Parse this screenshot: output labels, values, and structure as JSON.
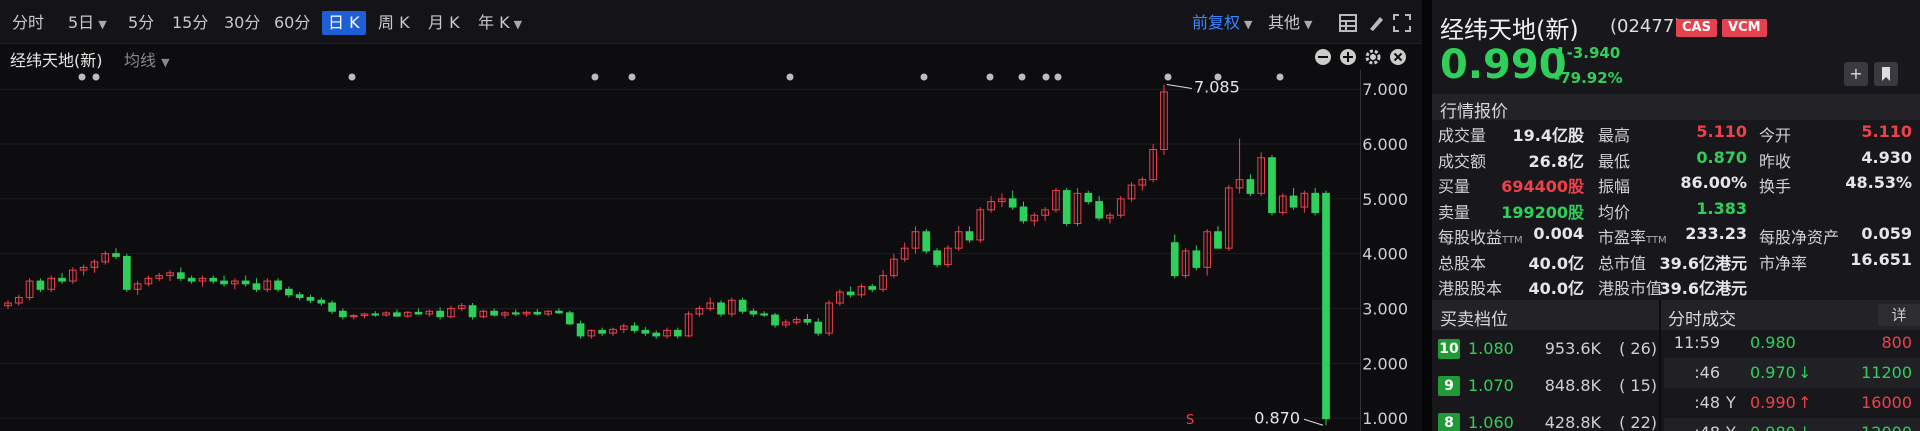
{
  "toolbar": {
    "periods": [
      {
        "label": "分时",
        "caret": false,
        "active": false
      },
      {
        "label": "5日",
        "caret": true,
        "active": false
      },
      {
        "label": "5分",
        "caret": false,
        "active": false
      },
      {
        "label": "15分",
        "caret": false,
        "active": false
      },
      {
        "label": "30分",
        "caret": false,
        "active": false
      },
      {
        "label": "60分",
        "caret": false,
        "active": false
      },
      {
        "label": "日 K",
        "caret": false,
        "active": true
      },
      {
        "label": "周 K",
        "caret": false,
        "active": false
      },
      {
        "label": "月 K",
        "caret": false,
        "active": false
      },
      {
        "label": "年 K",
        "caret": true,
        "active": false
      }
    ],
    "adjust_label": "前复权",
    "other_label": "其他"
  },
  "chart_header": {
    "symbol_label": "经纬天地(新)",
    "indicator_label": "均线"
  },
  "chart_data": {
    "type": "candlestick",
    "y_axis_ticks": [
      "7.000",
      "6.000",
      "5.000",
      "4.000",
      "3.000",
      "2.000",
      "1.000"
    ],
    "ylim": [
      0.82,
      7.35
    ],
    "max_annotation": "7.085",
    "min_annotation": "0.870",
    "marker_label": "S",
    "colors": {
      "up": "#f0404a",
      "down": "#2fd05a"
    },
    "candles": [
      [
        3.05,
        3.15,
        3.0,
        3.1
      ],
      [
        3.1,
        3.25,
        3.05,
        3.2
      ],
      [
        3.2,
        3.55,
        3.15,
        3.5
      ],
      [
        3.5,
        3.55,
        3.3,
        3.35
      ],
      [
        3.35,
        3.6,
        3.3,
        3.55
      ],
      [
        3.55,
        3.65,
        3.45,
        3.5
      ],
      [
        3.5,
        3.75,
        3.45,
        3.7
      ],
      [
        3.7,
        3.8,
        3.6,
        3.75
      ],
      [
        3.75,
        3.9,
        3.65,
        3.85
      ],
      [
        3.85,
        4.05,
        3.8,
        4.0
      ],
      [
        4.0,
        4.1,
        3.9,
        3.95
      ],
      [
        3.95,
        4.0,
        3.3,
        3.35
      ],
      [
        3.35,
        3.5,
        3.25,
        3.45
      ],
      [
        3.45,
        3.6,
        3.4,
        3.55
      ],
      [
        3.55,
        3.65,
        3.5,
        3.6
      ],
      [
        3.6,
        3.7,
        3.5,
        3.65
      ],
      [
        3.65,
        3.75,
        3.5,
        3.55
      ],
      [
        3.55,
        3.6,
        3.45,
        3.5
      ],
      [
        3.5,
        3.6,
        3.4,
        3.55
      ],
      [
        3.55,
        3.6,
        3.45,
        3.5
      ],
      [
        3.5,
        3.6,
        3.4,
        3.45
      ],
      [
        3.45,
        3.55,
        3.35,
        3.5
      ],
      [
        3.5,
        3.6,
        3.4,
        3.45
      ],
      [
        3.45,
        3.55,
        3.3,
        3.35
      ],
      [
        3.35,
        3.55,
        3.3,
        3.5
      ],
      [
        3.5,
        3.55,
        3.3,
        3.35
      ],
      [
        3.35,
        3.4,
        3.2,
        3.25
      ],
      [
        3.25,
        3.3,
        3.15,
        3.2
      ],
      [
        3.2,
        3.25,
        3.1,
        3.15
      ],
      [
        3.15,
        3.2,
        3.05,
        3.1
      ],
      [
        3.1,
        3.15,
        2.9,
        2.95
      ],
      [
        2.95,
        3.0,
        2.8,
        2.85
      ],
      [
        2.85,
        2.9,
        2.8,
        2.87
      ],
      [
        2.87,
        2.92,
        2.82,
        2.9
      ],
      [
        2.9,
        2.95,
        2.85,
        2.88
      ],
      [
        2.88,
        2.95,
        2.85,
        2.92
      ],
      [
        2.92,
        2.98,
        2.85,
        2.86
      ],
      [
        2.86,
        2.95,
        2.83,
        2.93
      ],
      [
        2.93,
        3.0,
        2.88,
        2.9
      ],
      [
        2.9,
        2.98,
        2.85,
        2.95
      ],
      [
        2.95,
        3.02,
        2.8,
        2.85
      ],
      [
        2.85,
        3.05,
        2.82,
        3.0
      ],
      [
        3.0,
        3.1,
        2.95,
        3.05
      ],
      [
        3.05,
        3.1,
        2.8,
        2.85
      ],
      [
        2.85,
        2.98,
        2.82,
        2.95
      ],
      [
        2.95,
        3.0,
        2.85,
        2.88
      ],
      [
        2.88,
        2.95,
        2.82,
        2.92
      ],
      [
        2.92,
        2.98,
        2.86,
        2.9
      ],
      [
        2.9,
        2.96,
        2.85,
        2.93
      ],
      [
        2.93,
        2.99,
        2.87,
        2.9
      ],
      [
        2.9,
        2.97,
        2.86,
        2.95
      ],
      [
        2.95,
        3.0,
        2.9,
        2.92
      ],
      [
        2.92,
        2.96,
        2.7,
        2.72
      ],
      [
        2.72,
        2.78,
        2.45,
        2.5
      ],
      [
        2.5,
        2.62,
        2.45,
        2.6
      ],
      [
        2.6,
        2.65,
        2.5,
        2.55
      ],
      [
        2.55,
        2.65,
        2.5,
        2.62
      ],
      [
        2.62,
        2.72,
        2.55,
        2.68
      ],
      [
        2.68,
        2.75,
        2.55,
        2.6
      ],
      [
        2.6,
        2.66,
        2.5,
        2.55
      ],
      [
        2.55,
        2.6,
        2.45,
        2.5
      ],
      [
        2.5,
        2.65,
        2.45,
        2.6
      ],
      [
        2.6,
        2.65,
        2.45,
        2.5
      ],
      [
        2.5,
        2.95,
        2.48,
        2.9
      ],
      [
        2.9,
        3.05,
        2.85,
        3.0
      ],
      [
        3.0,
        3.2,
        2.95,
        3.1
      ],
      [
        3.1,
        3.15,
        2.85,
        2.9
      ],
      [
        2.9,
        3.2,
        2.85,
        3.15
      ],
      [
        3.15,
        3.2,
        2.9,
        2.95
      ],
      [
        2.95,
        3.0,
        2.85,
        2.9
      ],
      [
        2.9,
        2.95,
        2.85,
        2.88
      ],
      [
        2.88,
        2.92,
        2.65,
        2.7
      ],
      [
        2.7,
        2.8,
        2.65,
        2.75
      ],
      [
        2.75,
        2.85,
        2.7,
        2.8
      ],
      [
        2.8,
        2.9,
        2.7,
        2.75
      ],
      [
        2.75,
        2.82,
        2.5,
        2.55
      ],
      [
        2.55,
        3.15,
        2.5,
        3.1
      ],
      [
        3.1,
        3.35,
        3.05,
        3.3
      ],
      [
        3.3,
        3.4,
        3.2,
        3.25
      ],
      [
        3.25,
        3.45,
        3.2,
        3.4
      ],
      [
        3.4,
        3.45,
        3.3,
        3.35
      ],
      [
        3.35,
        3.7,
        3.3,
        3.6
      ],
      [
        3.6,
        4.0,
        3.55,
        3.9
      ],
      [
        3.9,
        4.2,
        3.85,
        4.1
      ],
      [
        4.1,
        4.5,
        4.0,
        4.4
      ],
      [
        4.4,
        4.45,
        4.0,
        4.05
      ],
      [
        4.05,
        4.1,
        3.75,
        3.8
      ],
      [
        3.8,
        4.15,
        3.75,
        4.1
      ],
      [
        4.1,
        4.5,
        4.05,
        4.4
      ],
      [
        4.4,
        4.5,
        4.2,
        4.25
      ],
      [
        4.25,
        4.85,
        4.2,
        4.8
      ],
      [
        4.8,
        5.05,
        4.75,
        4.95
      ],
      [
        4.95,
        5.1,
        4.85,
        5.0
      ],
      [
        5.0,
        5.15,
        4.8,
        4.85
      ],
      [
        4.85,
        4.95,
        4.55,
        4.6
      ],
      [
        4.6,
        4.75,
        4.5,
        4.7
      ],
      [
        4.7,
        4.85,
        4.6,
        4.8
      ],
      [
        4.8,
        5.2,
        4.75,
        5.15
      ],
      [
        5.15,
        5.2,
        4.5,
        4.55
      ],
      [
        4.55,
        5.2,
        4.5,
        5.1
      ],
      [
        5.1,
        5.15,
        4.9,
        4.95
      ],
      [
        4.95,
        5.05,
        4.6,
        4.65
      ],
      [
        4.65,
        4.75,
        4.55,
        4.7
      ],
      [
        4.7,
        5.05,
        4.65,
        5.0
      ],
      [
        5.0,
        5.3,
        4.95,
        5.25
      ],
      [
        5.25,
        5.4,
        5.15,
        5.35
      ],
      [
        5.35,
        6.0,
        5.3,
        5.9
      ],
      [
        5.9,
        7.085,
        5.8,
        6.95
      ],
      [
        4.2,
        4.35,
        3.55,
        3.6
      ],
      [
        3.6,
        4.1,
        3.55,
        4.05
      ],
      [
        4.05,
        4.15,
        3.7,
        3.75
      ],
      [
        3.75,
        4.45,
        3.6,
        4.4
      ],
      [
        4.4,
        4.5,
        4.1,
        4.1
      ],
      [
        4.1,
        5.25,
        4.05,
        5.2
      ],
      [
        5.2,
        6.1,
        5.1,
        5.35
      ],
      [
        5.35,
        5.45,
        5.05,
        5.1
      ],
      [
        5.1,
        5.85,
        5.05,
        5.75
      ],
      [
        5.75,
        5.8,
        4.7,
        4.75
      ],
      [
        4.75,
        5.1,
        4.7,
        5.05
      ],
      [
        5.05,
        5.2,
        4.8,
        4.85
      ],
      [
        4.85,
        5.15,
        4.75,
        5.1
      ],
      [
        5.1,
        5.2,
        4.7,
        4.75
      ],
      [
        5.1,
        5.15,
        0.87,
        0.99
      ]
    ]
  },
  "quote": {
    "name": "经纬天地(新)",
    "code": "(02477)",
    "badges": [
      "CAS",
      "VCM"
    ],
    "price": "0.990",
    "change": "-3.940",
    "change_pct": "-79.92%",
    "section_title": "行情报价",
    "rows": [
      [
        {
          "label": "成交量",
          "value": "19.4亿股",
          "color": "white"
        },
        {
          "label": "最高",
          "value": "5.110",
          "color": "red"
        },
        {
          "label": "今开",
          "value": "5.110",
          "color": "red"
        }
      ],
      [
        {
          "label": "成交额",
          "value": "26.8亿",
          "color": "white"
        },
        {
          "label": "最低",
          "value": "0.870",
          "color": "green"
        },
        {
          "label": "昨收",
          "value": "4.930",
          "color": "white"
        }
      ],
      [
        {
          "label": "买量",
          "value": "694400股",
          "color": "red"
        },
        {
          "label": "振幅",
          "value": "86.00%",
          "color": "white"
        },
        {
          "label": "换手",
          "value": "48.53%",
          "color": "white"
        }
      ],
      [
        {
          "label": "卖量",
          "value": "199200股",
          "color": "green"
        },
        {
          "label": "均价",
          "value": "1.383",
          "color": "green"
        },
        {
          "label": "",
          "value": "",
          "color": "white"
        }
      ],
      [
        {
          "label": "每股收益",
          "sub": "TTM",
          "value": "0.004",
          "color": "white"
        },
        {
          "label": "市盈率",
          "sub": "TTM",
          "value": "233.23",
          "color": "white"
        },
        {
          "label": "每股净资产",
          "value": "0.059",
          "color": "white"
        }
      ],
      [
        {
          "label": "总股本",
          "value": "40.0亿",
          "color": "white"
        },
        {
          "label": "总市值",
          "value": "39.6亿港元",
          "color": "white"
        },
        {
          "label": "市净率",
          "value": "16.651",
          "color": "white"
        }
      ],
      [
        {
          "label": "港股股本",
          "value": "40.0亿",
          "color": "white"
        },
        {
          "label": "港股市值",
          "value": "39.6亿港元",
          "color": "white"
        },
        {
          "label": "",
          "value": "",
          "color": "white"
        }
      ]
    ]
  },
  "order_book": {
    "title": "买卖档位",
    "levels": [
      {
        "level": "10",
        "price": "1.080",
        "volume": "953.6K",
        "orders": "( 26)"
      },
      {
        "level": "9",
        "price": "1.070",
        "volume": "848.8K",
        "orders": "( 15)"
      },
      {
        "level": "8",
        "price": "1.060",
        "volume": "428.8K",
        "orders": "( 22)"
      }
    ]
  },
  "ticks": {
    "title": "分时成交",
    "detail_label": "详",
    "rows": [
      {
        "time": "11:59",
        "flag": "",
        "price": "0.980",
        "arrow": "",
        "volume": "800"
      },
      {
        "time": ":46",
        "flag": "",
        "price": "0.970",
        "arrow": "↓",
        "volume": "11200"
      },
      {
        "time": ":48",
        "flag": "Y",
        "price": "0.990",
        "arrow": "↑",
        "volume": "16000"
      },
      {
        "time": ":48",
        "flag": "Y",
        "price": "0.980",
        "arrow": "↓",
        "volume": "12000"
      }
    ]
  }
}
